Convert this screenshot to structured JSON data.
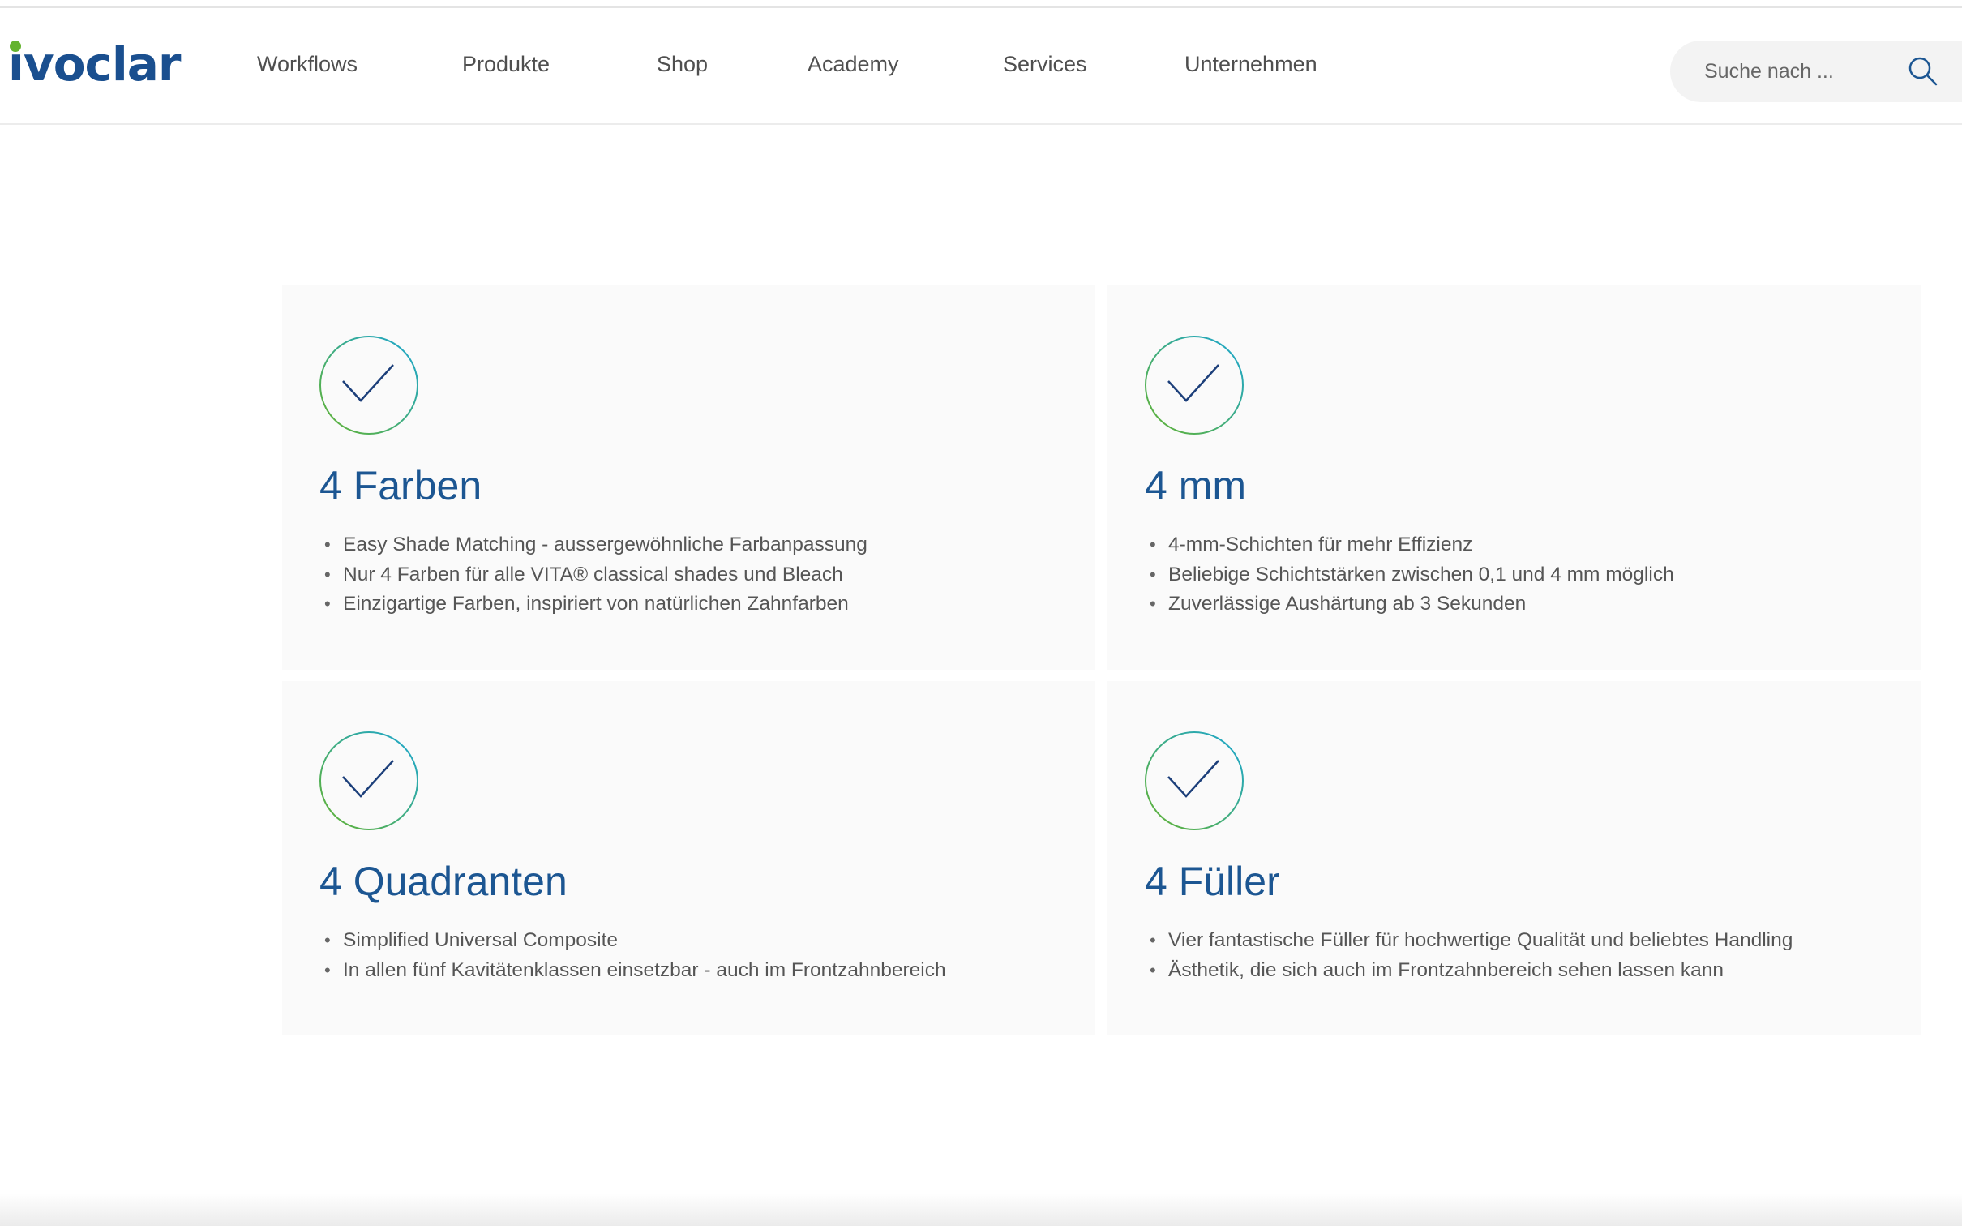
{
  "brand": {
    "logo_text": "ivoclar",
    "logo_color": "#1a4f8f",
    "logo_dot_color": "#64b32e"
  },
  "nav": {
    "items": [
      {
        "label": "Workflows"
      },
      {
        "label": "Produkte"
      },
      {
        "label": "Shop"
      },
      {
        "label": "Academy"
      },
      {
        "label": "Services"
      },
      {
        "label": "Unternehmen"
      }
    ]
  },
  "search": {
    "placeholder": "Suche nach ...",
    "icon": "search-icon"
  },
  "colors": {
    "title": "#1c5692",
    "check_stroke": "#1c3f7a",
    "ring_gradient_start": "#64b32e",
    "ring_gradient_end": "#1aa6d4",
    "card_bg": "#fafafa"
  },
  "features": [
    {
      "icon": "check-circle-icon",
      "title": "4 Farben",
      "bullets": [
        "Easy Shade Matching - aussergewöhnliche Farbanpassung",
        "Nur 4 Farben für alle VITA® classical shades und Bleach",
        "Einzigartige Farben, inspiriert von natürlichen Zahnfarben"
      ]
    },
    {
      "icon": "check-circle-icon",
      "title": "4 mm",
      "bullets": [
        "4-mm-Schichten für mehr Effizienz",
        "Beliebige Schichtstärken zwischen 0,1 und 4 mm möglich",
        "Zuverlässige Aushärtung ab 3 Sekunden"
      ]
    },
    {
      "icon": "check-circle-icon",
      "title": "4 Quadranten",
      "bullets": [
        "Simplified Universal Composite",
        "In allen fünf Kavitätenklassen einsetzbar - auch im Frontzahnbereich"
      ]
    },
    {
      "icon": "check-circle-icon",
      "title": "4 Füller",
      "bullets": [
        "Vier fantastische Füller für hochwertige Qualität und beliebtes Handling",
        "Ästhetik, die sich auch im Frontzahnbereich sehen lassen kann"
      ]
    }
  ]
}
